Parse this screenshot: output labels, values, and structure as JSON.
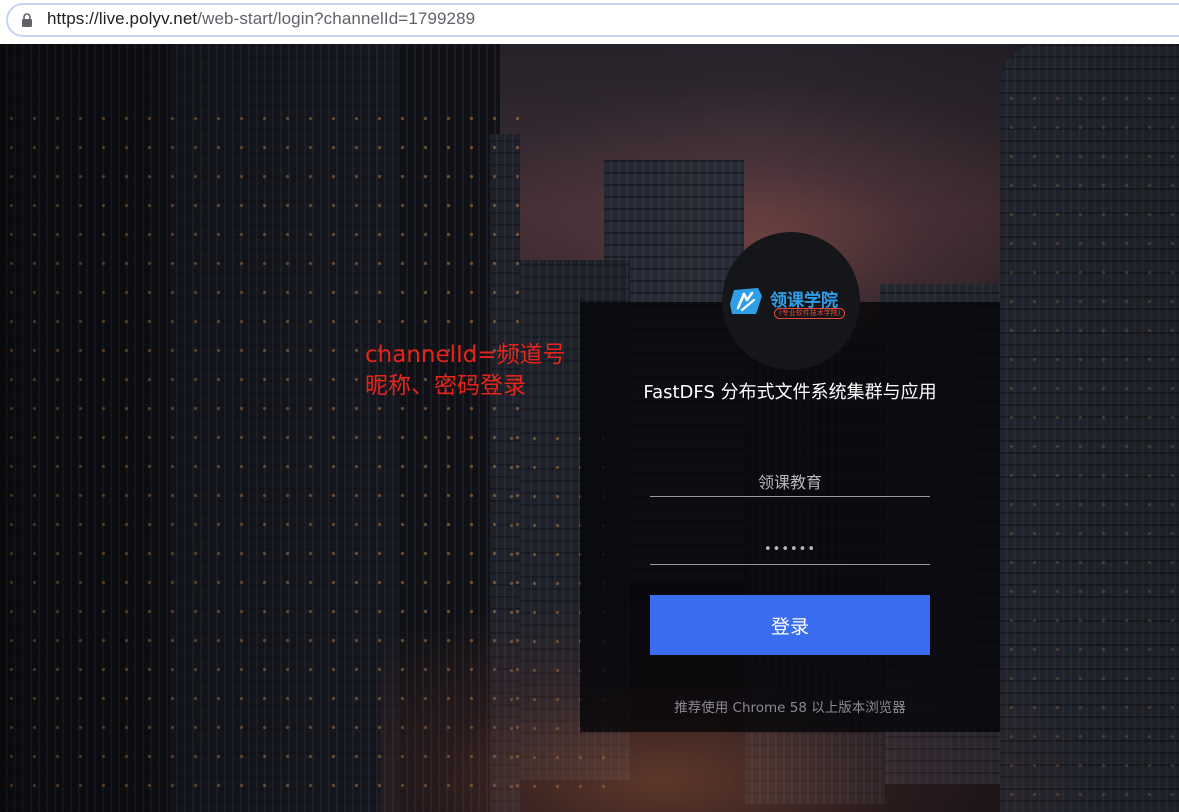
{
  "browser": {
    "url_scheme": "https://",
    "url_domain": "live.polyv.net",
    "url_path": "/web-start/login?channelId=1799289",
    "lock_icon": "lock-icon"
  },
  "annotation": {
    "line1": "channelId=频道号",
    "line2": "昵称、密码登录",
    "color": "#e8231c"
  },
  "login": {
    "logo_name": "领课学院",
    "logo_tagline": "(专业软件技术学院)",
    "course_title": "FastDFS 分布式文件系统集群与应用",
    "nickname_value": "领课教育",
    "password_value": "••••••",
    "submit_label": "登录",
    "browser_hint": "推荐使用 Chrome 58 以上版本浏览器",
    "accent_color": "#3a6df0"
  }
}
